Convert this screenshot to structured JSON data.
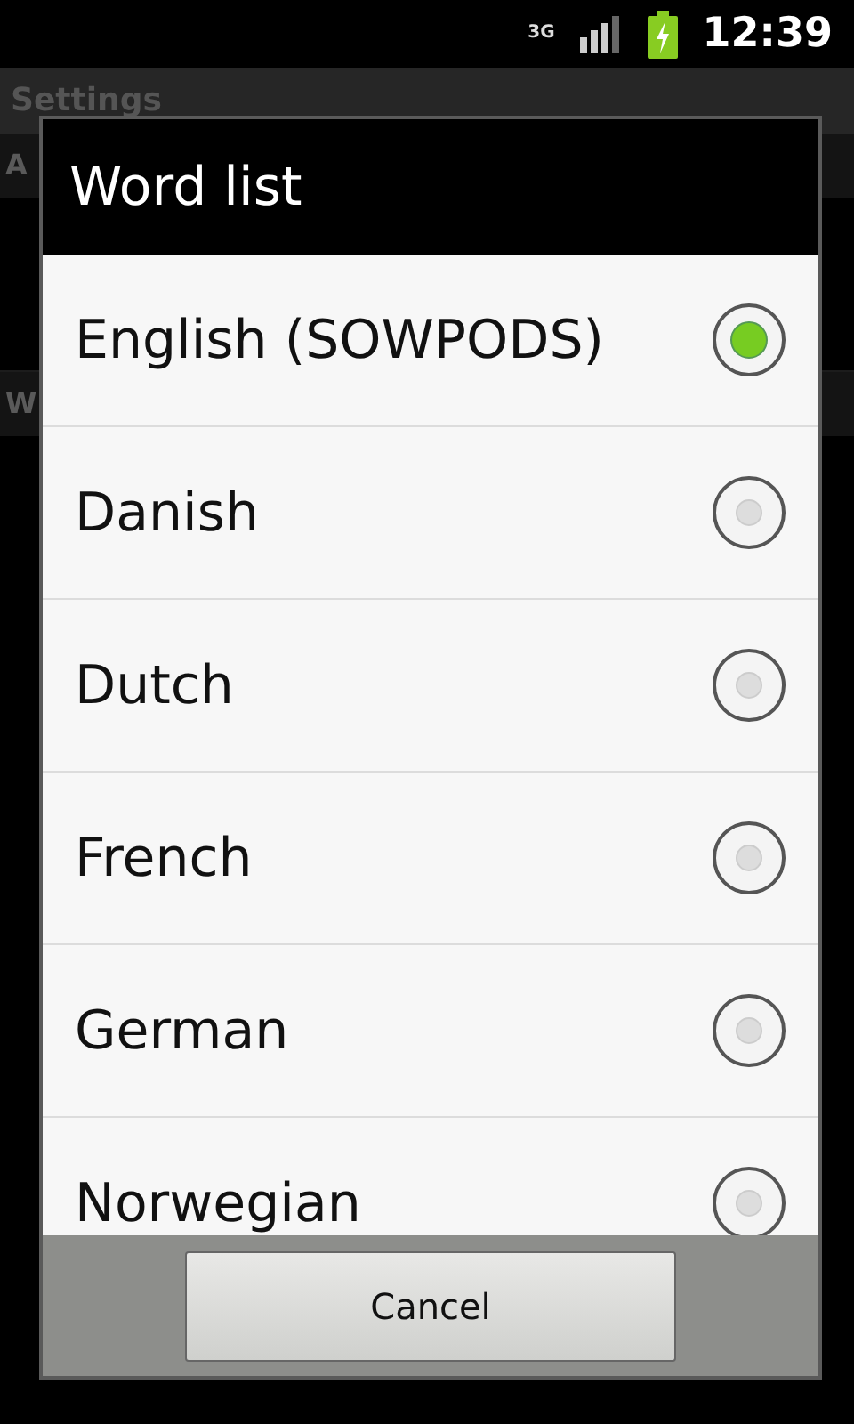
{
  "status_bar": {
    "time": "12:39",
    "network": "3G"
  },
  "background": {
    "title": "Settings",
    "headers": [
      "A",
      "W"
    ]
  },
  "dialog": {
    "title": "Word list",
    "options": [
      {
        "label": "English (SOWPODS)",
        "selected": true
      },
      {
        "label": "Danish",
        "selected": false
      },
      {
        "label": "Dutch",
        "selected": false
      },
      {
        "label": "French",
        "selected": false
      },
      {
        "label": "German",
        "selected": false
      },
      {
        "label": "Norwegian",
        "selected": false
      }
    ],
    "buttons": [
      "Cancel"
    ]
  }
}
